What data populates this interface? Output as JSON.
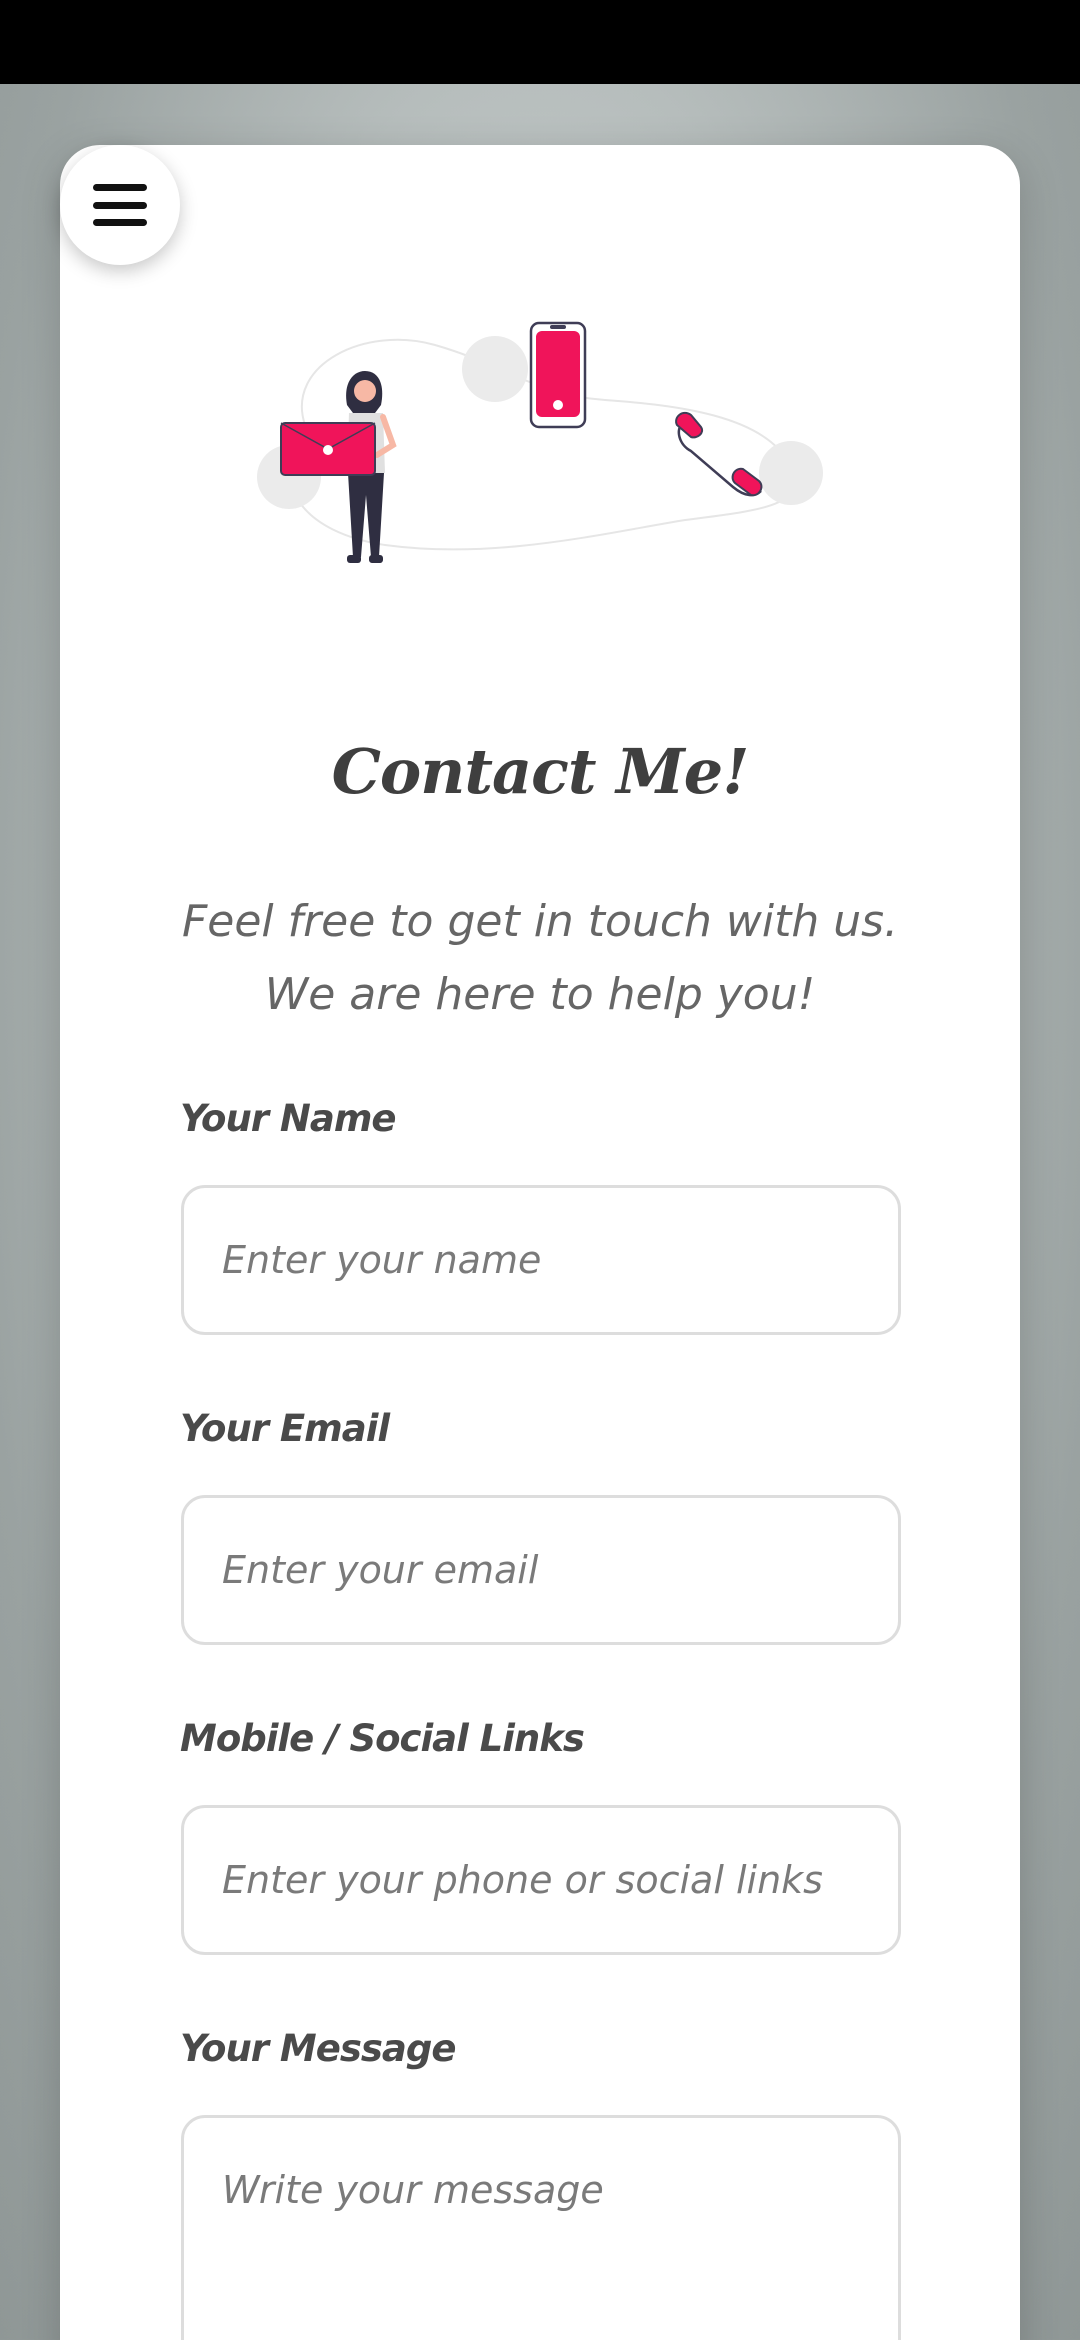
{
  "page": {
    "title": "Contact Me!",
    "subtitle_line1": "Feel free to get in touch with us.",
    "subtitle_line2": "We are here to help you!"
  },
  "form": {
    "name": {
      "label": "Your Name",
      "placeholder": "Enter your name",
      "value": ""
    },
    "email": {
      "label": "Your Email",
      "placeholder": "Enter your email",
      "value": ""
    },
    "links": {
      "label": "Mobile / Social Links",
      "placeholder": "Enter your phone or social links",
      "value": ""
    },
    "message": {
      "label": "Your Message",
      "placeholder": "Write your message",
      "value": ""
    }
  },
  "icons": {
    "menu": "hamburger-menu-icon",
    "illustration": "contact-illustration"
  },
  "colors": {
    "accent": "#f0145a",
    "text_dark": "#3f3f3f",
    "text_muted": "#666666",
    "card_bg": "#ffffff"
  }
}
